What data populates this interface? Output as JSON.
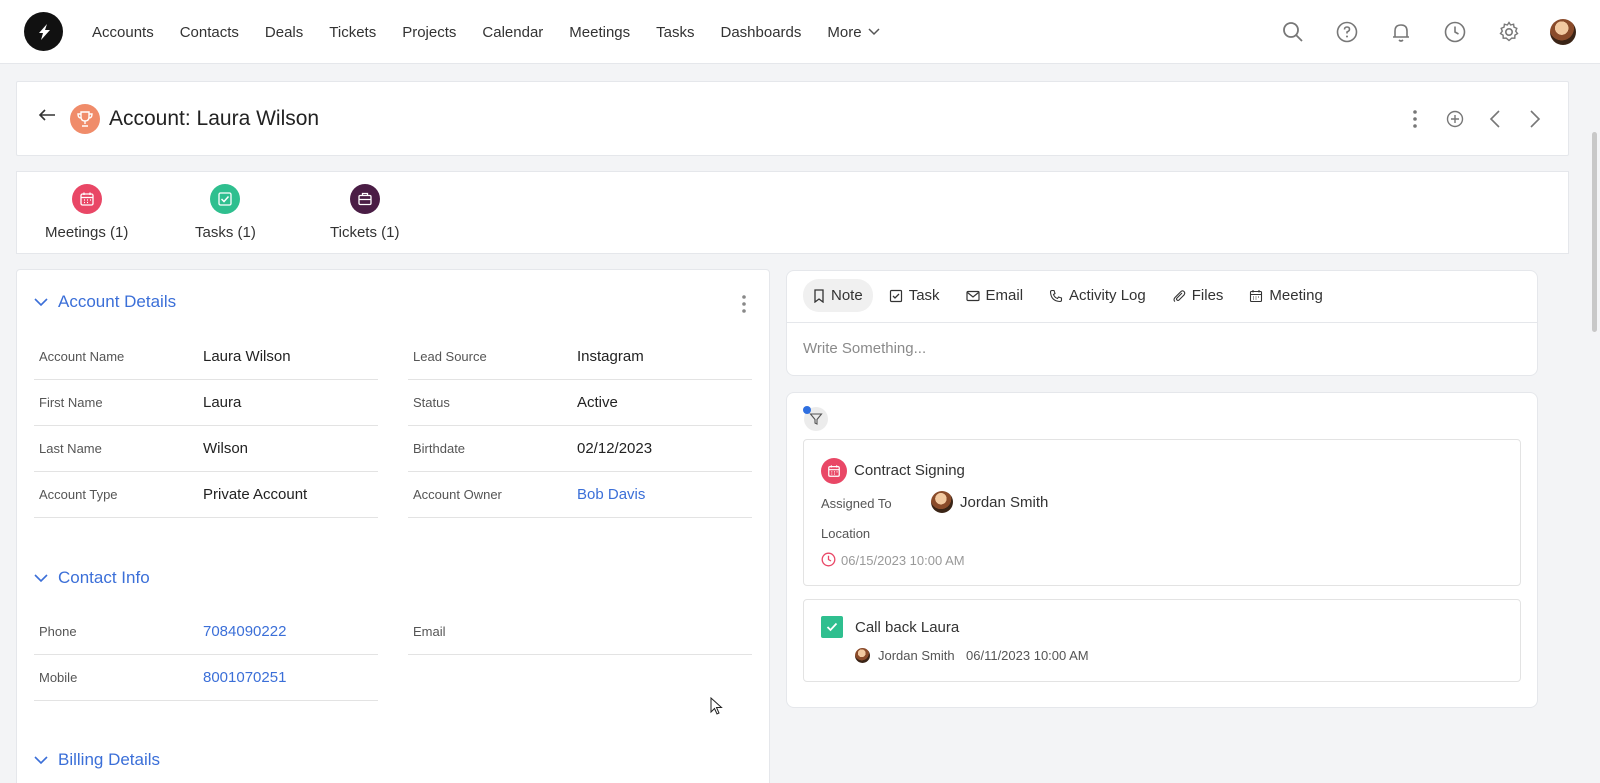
{
  "nav": {
    "items": [
      "Accounts",
      "Contacts",
      "Deals",
      "Tickets",
      "Projects",
      "Calendar",
      "Meetings",
      "Tasks",
      "Dashboards"
    ],
    "more_label": "More",
    "icons": [
      "search-icon",
      "help-icon",
      "bell-icon",
      "clock-icon",
      "gear-icon",
      "user-avatar"
    ]
  },
  "header": {
    "title": "Account: Laura Wilson"
  },
  "related": [
    {
      "label": "Meetings (1)",
      "color": "#e94766",
      "icon": "calendar-icon"
    },
    {
      "label": "Tasks (1)",
      "color": "#2fbf8f",
      "icon": "checkbox-icon"
    },
    {
      "label": "Tickets (1)",
      "color": "#4a1d45",
      "icon": "ticket-icon"
    }
  ],
  "details": {
    "account_section": "Account Details",
    "contact_section": "Contact Info",
    "billing_section": "Billing Details",
    "account_fields": {
      "left": [
        {
          "label": "Account Name",
          "value": "Laura Wilson"
        },
        {
          "label": "First Name",
          "value": "Laura"
        },
        {
          "label": "Last Name",
          "value": "Wilson"
        },
        {
          "label": "Account Type",
          "value": "Private Account"
        }
      ],
      "right": [
        {
          "label": "Lead Source",
          "value": "Instagram"
        },
        {
          "label": "Status",
          "value": "Active"
        },
        {
          "label": "Birthdate",
          "value": "02/12/2023"
        },
        {
          "label": "Account Owner",
          "value": "Bob Davis"
        }
      ]
    },
    "contact_fields": {
      "left": [
        {
          "label": "Phone",
          "value": "7084090222"
        },
        {
          "label": "Mobile",
          "value": "8001070251"
        }
      ],
      "right": [
        {
          "label": "Email",
          "value": ""
        }
      ]
    }
  },
  "composer": {
    "tabs": [
      "Note",
      "Task",
      "Email",
      "Activity Log",
      "Files",
      "Meeting"
    ],
    "placeholder": "Write Something..."
  },
  "timeline": {
    "meeting": {
      "title": "Contract Signing",
      "assigned_label": "Assigned To",
      "assigned_name": "Jordan Smith",
      "location_label": "Location",
      "datetime": "06/15/2023 10:00 AM"
    },
    "task": {
      "title": "Call back Laura",
      "owner": "Jordan Smith",
      "datetime": "06/11/2023 10:00 AM"
    }
  },
  "colors": {
    "link": "#3b6fd8",
    "meeting": "#e94766",
    "task": "#2fbf8f",
    "ticket": "#4a1d45",
    "trophy": "#f08c6a"
  }
}
